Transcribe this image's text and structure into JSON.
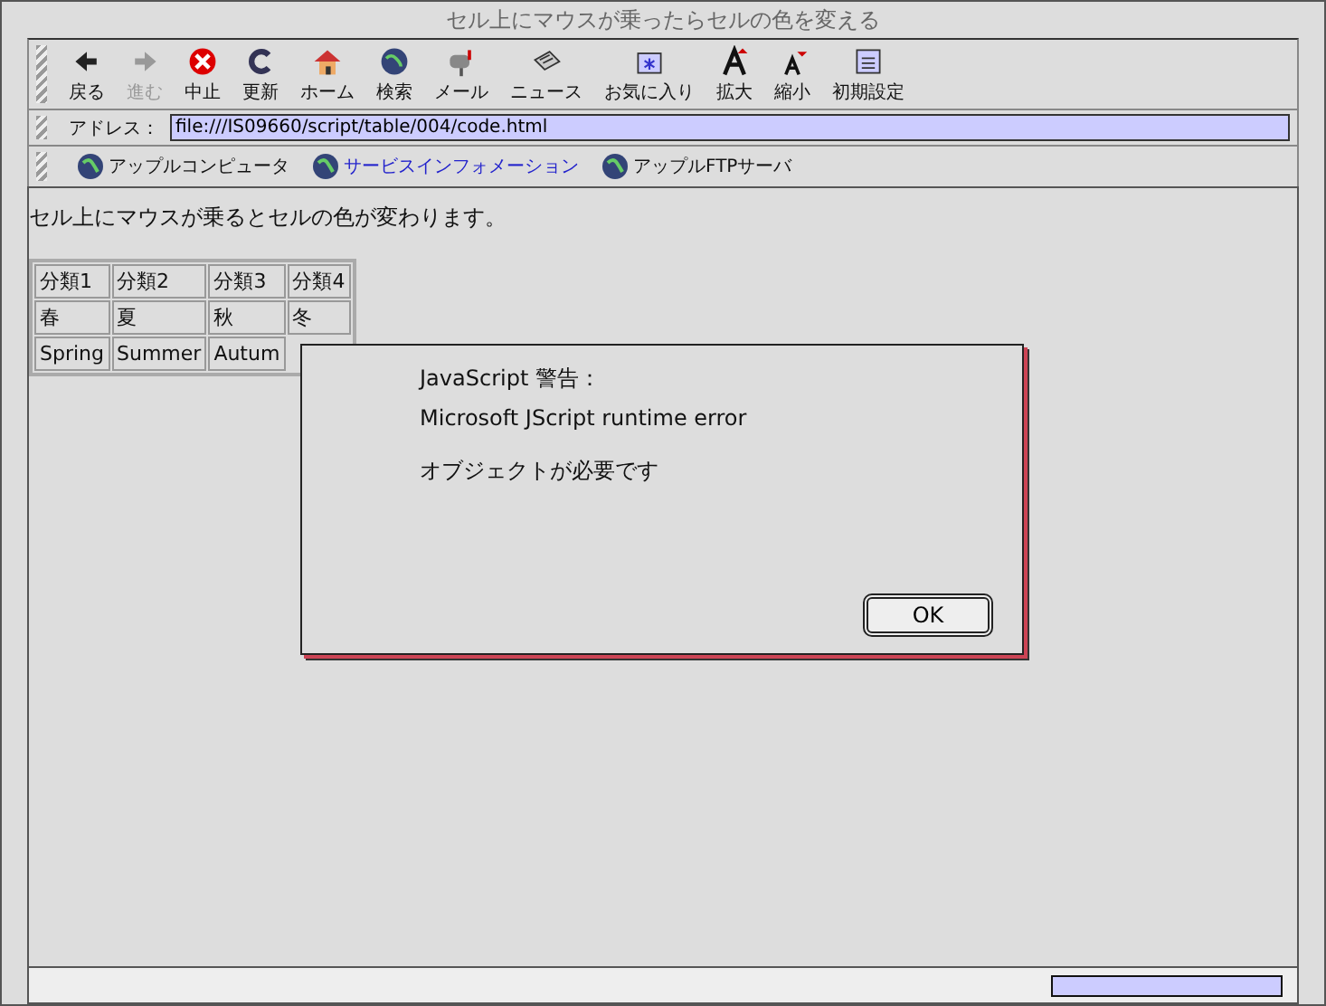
{
  "window": {
    "title": "セル上にマウスが乗ったらセルの色を変える"
  },
  "toolbar": [
    {
      "label": "戻る",
      "kind": "back",
      "disabled": false
    },
    {
      "label": "進む",
      "kind": "forward",
      "disabled": true
    },
    {
      "label": "中止",
      "kind": "stop",
      "disabled": false
    },
    {
      "label": "更新",
      "kind": "refresh",
      "disabled": false
    },
    {
      "label": "ホーム",
      "kind": "home",
      "disabled": false
    },
    {
      "label": "検索",
      "kind": "globe",
      "disabled": false
    },
    {
      "label": "メール",
      "kind": "mail",
      "disabled": false
    },
    {
      "label": "ニュース",
      "kind": "news",
      "disabled": false
    },
    {
      "label": "お気に入り",
      "kind": "favorites",
      "disabled": false
    },
    {
      "label": "拡大",
      "kind": "larger",
      "disabled": false
    },
    {
      "label": "縮小",
      "kind": "smaller",
      "disabled": false
    },
    {
      "label": "初期設定",
      "kind": "prefs",
      "disabled": false
    }
  ],
  "address": {
    "label": "アドレス：",
    "value": "file:///IS09660/script/table/004/code.html"
  },
  "links": [
    {
      "label": "アップルコンピュータ",
      "visited": false
    },
    {
      "label": "サービスインフォメーション",
      "visited": true
    },
    {
      "label": "アップルFTPサーバ",
      "visited": false
    }
  ],
  "content": {
    "text": "セル上にマウスが乗るとセルの色が変わります。",
    "table": {
      "rows": [
        [
          "分類1",
          "分類2",
          "分類3",
          "分類4"
        ],
        [
          "春",
          "夏",
          "秋",
          "冬"
        ],
        [
          "Spring",
          "Summer",
          "Autum"
        ]
      ]
    }
  },
  "dialog": {
    "title": "JavaScript 警告：",
    "lines": [
      "Microsoft JScript runtime error",
      "オブジェクトが必要です"
    ],
    "button": "OK"
  },
  "status_bar": {
    "progress": {
      "level": 1
    }
  }
}
